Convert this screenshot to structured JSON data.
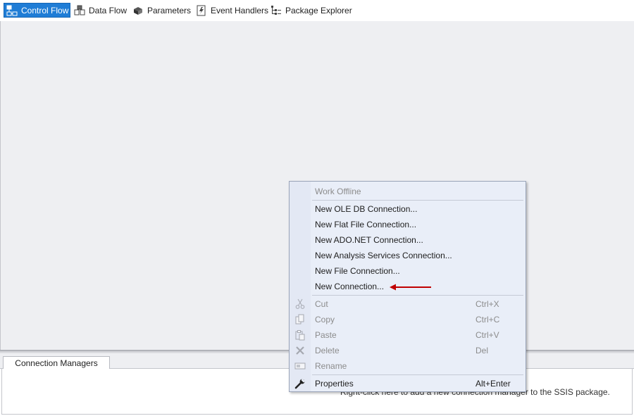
{
  "tabs": [
    {
      "label": "Control Flow",
      "icon": "control-flow-icon",
      "active": true
    },
    {
      "label": "Data Flow",
      "icon": "data-flow-icon",
      "active": false
    },
    {
      "label": "Parameters",
      "icon": "parameters-icon",
      "active": false
    },
    {
      "label": "Event Handlers",
      "icon": "event-handlers-icon",
      "active": false
    },
    {
      "label": "Package Explorer",
      "icon": "package-explorer-icon",
      "active": false
    }
  ],
  "connection_managers": {
    "tab_label": "Connection Managers",
    "hint": "Right-click here to add a new connection manager to the SSIS package."
  },
  "context_menu": {
    "items": [
      {
        "label": "Work Offline",
        "shortcut": "",
        "enabled": false
      },
      {
        "label": "New OLE DB Connection...",
        "shortcut": "",
        "enabled": true
      },
      {
        "label": "New Flat File Connection...",
        "shortcut": "",
        "enabled": true
      },
      {
        "label": "New ADO.NET Connection...",
        "shortcut": "",
        "enabled": true
      },
      {
        "label": "New Analysis Services Connection...",
        "shortcut": "",
        "enabled": true
      },
      {
        "label": "New File Connection...",
        "shortcut": "",
        "enabled": true
      },
      {
        "label": "New Connection...",
        "shortcut": "",
        "enabled": true
      },
      {
        "label": "Cut",
        "shortcut": "Ctrl+X",
        "enabled": false,
        "icon": "cut-icon"
      },
      {
        "label": "Copy",
        "shortcut": "Ctrl+C",
        "enabled": false,
        "icon": "copy-icon"
      },
      {
        "label": "Paste",
        "shortcut": "Ctrl+V",
        "enabled": false,
        "icon": "paste-icon"
      },
      {
        "label": "Delete",
        "shortcut": "Del",
        "enabled": false,
        "icon": "delete-icon"
      },
      {
        "label": "Rename",
        "shortcut": "",
        "enabled": false,
        "icon": "rename-icon"
      },
      {
        "label": "Properties",
        "shortcut": "Alt+Enter",
        "enabled": true,
        "icon": "wrench-icon"
      }
    ]
  },
  "colors": {
    "accent": "#1f7dd6",
    "annotation_arrow": "#c00000",
    "surface": "#eeeff2",
    "menu_background": "#e9eef8"
  }
}
